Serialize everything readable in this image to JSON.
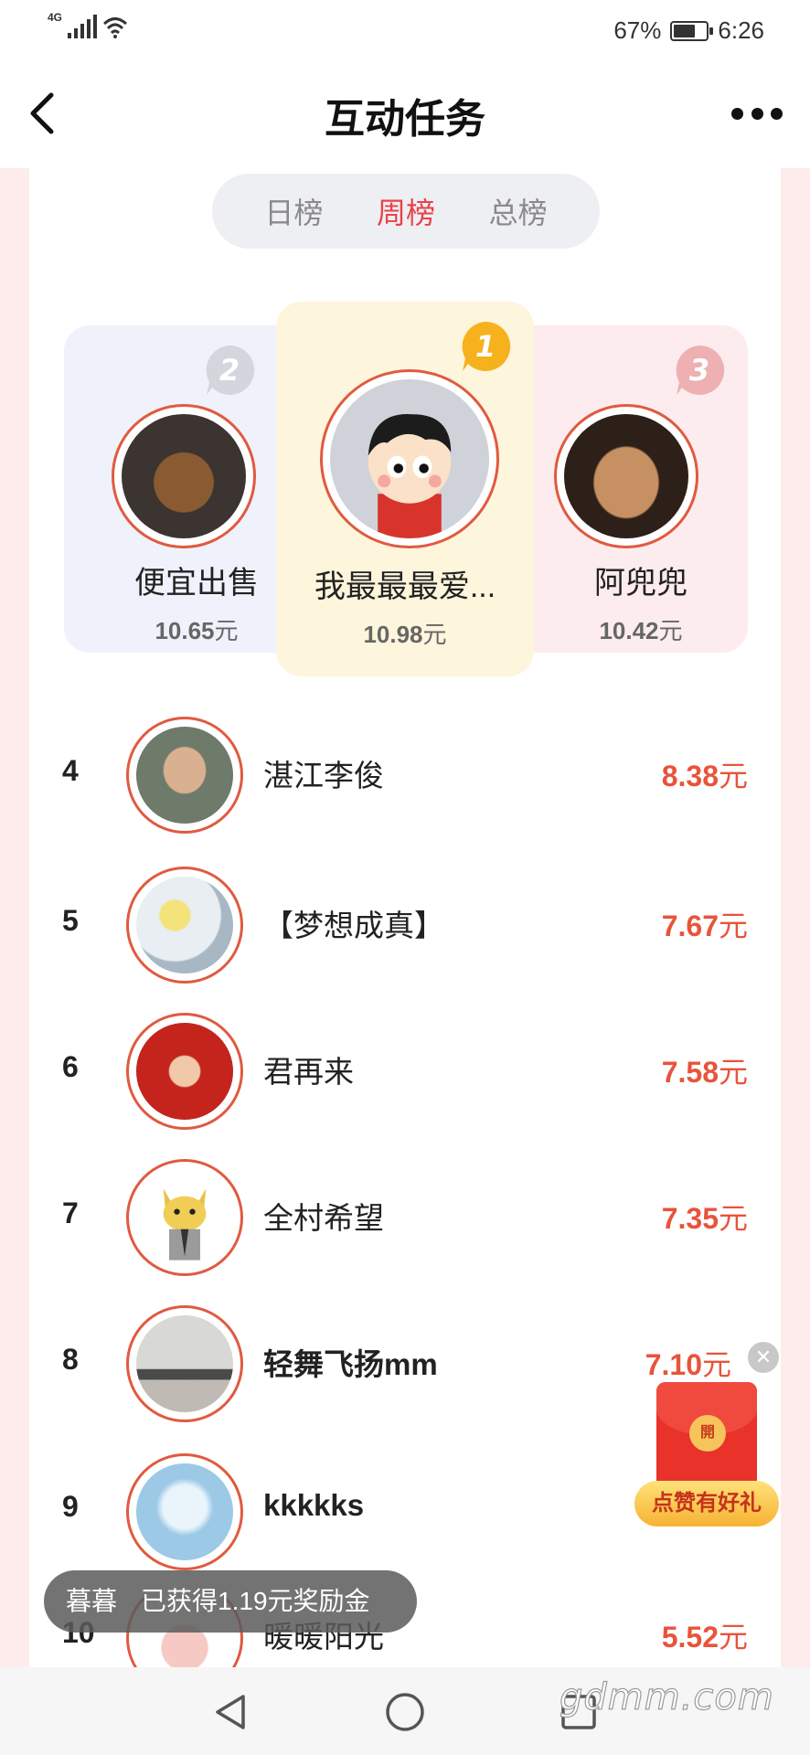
{
  "status_bar": {
    "network": "4G",
    "battery_percent": "67%",
    "battery_level": 0.67,
    "time": "6:26"
  },
  "header": {
    "title": "互动任务"
  },
  "tabs": [
    {
      "label": "日榜",
      "active": false
    },
    {
      "label": "周榜",
      "active": true
    },
    {
      "label": "总榜",
      "active": false
    }
  ],
  "podium": [
    {
      "rank": "2",
      "name": "便宜出售",
      "amount": "10.65",
      "unit": "元"
    },
    {
      "rank": "1",
      "name": "我最最最爱...",
      "amount": "10.98",
      "unit": "元"
    },
    {
      "rank": "3",
      "name": "阿兜兜",
      "amount": "10.42",
      "unit": "元"
    }
  ],
  "list": [
    {
      "rank": "4",
      "name": "湛江李俊",
      "amount": "8.38",
      "unit": "元"
    },
    {
      "rank": "5",
      "name": "【梦想成真】",
      "amount": "7.67",
      "unit": "元"
    },
    {
      "rank": "6",
      "name": "君再来",
      "amount": "7.58",
      "unit": "元"
    },
    {
      "rank": "7",
      "name": "全村希望",
      "amount": "7.35",
      "unit": "元"
    },
    {
      "rank": "8",
      "name": "轻舞飞扬mm",
      "amount": "7.10",
      "unit": "元"
    },
    {
      "rank": "9",
      "name": "kkkkks",
      "amount": "",
      "unit": ""
    },
    {
      "rank": "10",
      "name": "暖暖阳光",
      "amount": "5.52",
      "unit": "元"
    }
  ],
  "red_packet": {
    "coin_text": "開",
    "label": "点赞有好礼"
  },
  "toast": {
    "user": "暮暮",
    "message": "已获得1.19元奖励金"
  },
  "watermark": "gdmm.com",
  "colors": {
    "accent": "#e8424a",
    "amount": "#e8543a",
    "avatar_ring": "#e05a40",
    "podium_first_bg": "#fef5dd"
  }
}
